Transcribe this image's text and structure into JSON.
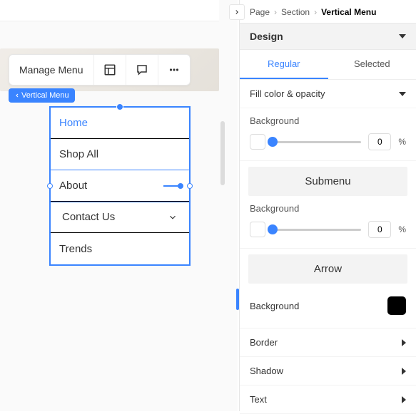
{
  "toolbar": {
    "label": "Manage Menu"
  },
  "badge": {
    "label": "Vertical Menu"
  },
  "menu": {
    "items": [
      {
        "label": "Home",
        "active": true
      },
      {
        "label": "Shop All"
      },
      {
        "label": "About",
        "selected": true
      },
      {
        "label": "Contact Us",
        "sub": true
      },
      {
        "label": "Trends"
      }
    ]
  },
  "breadcrumb": {
    "l1": "Page",
    "l2": "Section",
    "l3": "Vertical Menu"
  },
  "panel": {
    "designLabel": "Design",
    "tabRegular": "Regular",
    "tabSelected": "Selected",
    "fillLabel": "Fill color & opacity",
    "backgroundLabel": "Background",
    "submenuLabel": "Submenu",
    "arrowLabel": "Arrow",
    "borderLabel": "Border",
    "shadowLabel": "Shadow",
    "textLabel": "Text",
    "bgValue1": "0",
    "bgValue2": "0",
    "pct": "%"
  }
}
